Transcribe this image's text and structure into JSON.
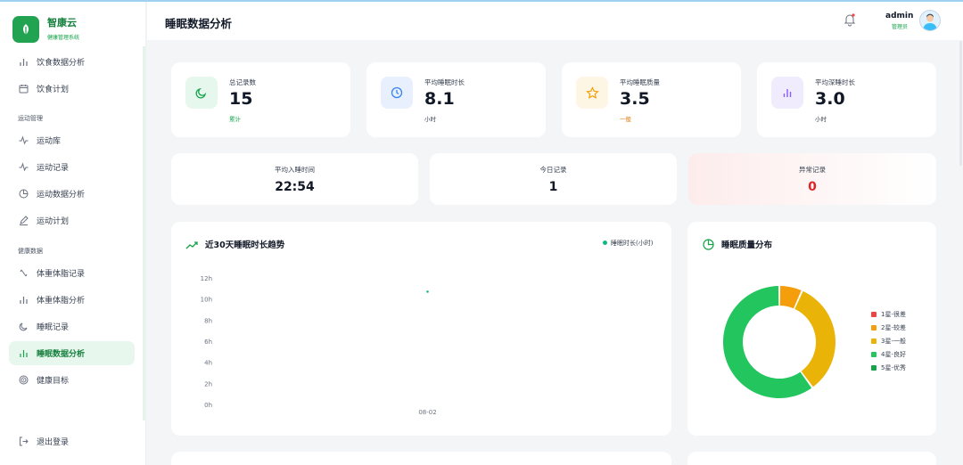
{
  "app": {
    "name": "智康云",
    "subtitle": "健康管理系统"
  },
  "sidebar": {
    "items_top": [
      {
        "label": "饮食数据分析",
        "icon": "bar-chart-icon"
      },
      {
        "label": "饮食计划",
        "icon": "calendar-icon"
      }
    ],
    "group_sport": "运动管理",
    "items_sport": [
      {
        "label": "运动库",
        "icon": "activity-icon"
      },
      {
        "label": "运动记录",
        "icon": "activity-icon"
      },
      {
        "label": "运动数据分析",
        "icon": "pie-chart-icon"
      },
      {
        "label": "运动计划",
        "icon": "pen-icon"
      }
    ],
    "group_health": "健康数据",
    "items_health": [
      {
        "label": "体重体脂记录",
        "icon": "scale-icon"
      },
      {
        "label": "体重体脂分析",
        "icon": "bar-chart-icon"
      },
      {
        "label": "睡眠记录",
        "icon": "moon-icon"
      },
      {
        "label": "睡眠数据分析",
        "icon": "bar-chart-icon"
      },
      {
        "label": "健康目标",
        "icon": "target-icon"
      }
    ],
    "logout": "退出登录"
  },
  "header": {
    "title": "睡眠数据分析",
    "user_name": "admin",
    "user_role": "管理员"
  },
  "stats": [
    {
      "label": "总记录数",
      "value": "15",
      "sub": "累计",
      "icon": "moon-icon"
    },
    {
      "label": "平均睡眠时长",
      "value": "8.1",
      "sub": "小时",
      "icon": "clock-icon"
    },
    {
      "label": "平均睡眠质量",
      "value": "3.5",
      "sub": "一般",
      "icon": "star-icon"
    },
    {
      "label": "平均深睡时长",
      "value": "3.0",
      "sub": "小时",
      "icon": "bar-chart-icon"
    }
  ],
  "mini_stats": [
    {
      "label": "平均入睡时间",
      "value": "22:54"
    },
    {
      "label": "今日记录",
      "value": "1"
    },
    {
      "label": "异常记录",
      "value": "0"
    }
  ],
  "colors": {
    "brand": "#22a352",
    "abnormal": "#dc2626"
  },
  "trend_chart": {
    "title": "近30天睡眠时长趋势",
    "chart_data": {
      "type": "line",
      "series": [
        {
          "name": "睡眠时长(小时)",
          "x": [
            "08-02"
          ],
          "values": [
            10.7
          ]
        }
      ],
      "categories": [
        "08-02"
      ],
      "ylim": [
        0,
        12
      ],
      "yticks": [
        "0h",
        "2h",
        "4h",
        "6h",
        "8h",
        "10h",
        "12h"
      ],
      "grid": false,
      "legend": "top-right"
    }
  },
  "quality_chart": {
    "title": "睡眠质量分布",
    "chart_data": {
      "type": "pie",
      "categories": [
        "1星-很差",
        "2星-较差",
        "3星-一般",
        "4星-良好",
        "5星-优秀"
      ],
      "values": [
        0,
        1,
        5,
        9,
        0
      ],
      "colors": [
        "#ef4444",
        "#f59e0b",
        "#eab308",
        "#22c55e",
        "#16a34a"
      ],
      "legend": "right"
    }
  }
}
